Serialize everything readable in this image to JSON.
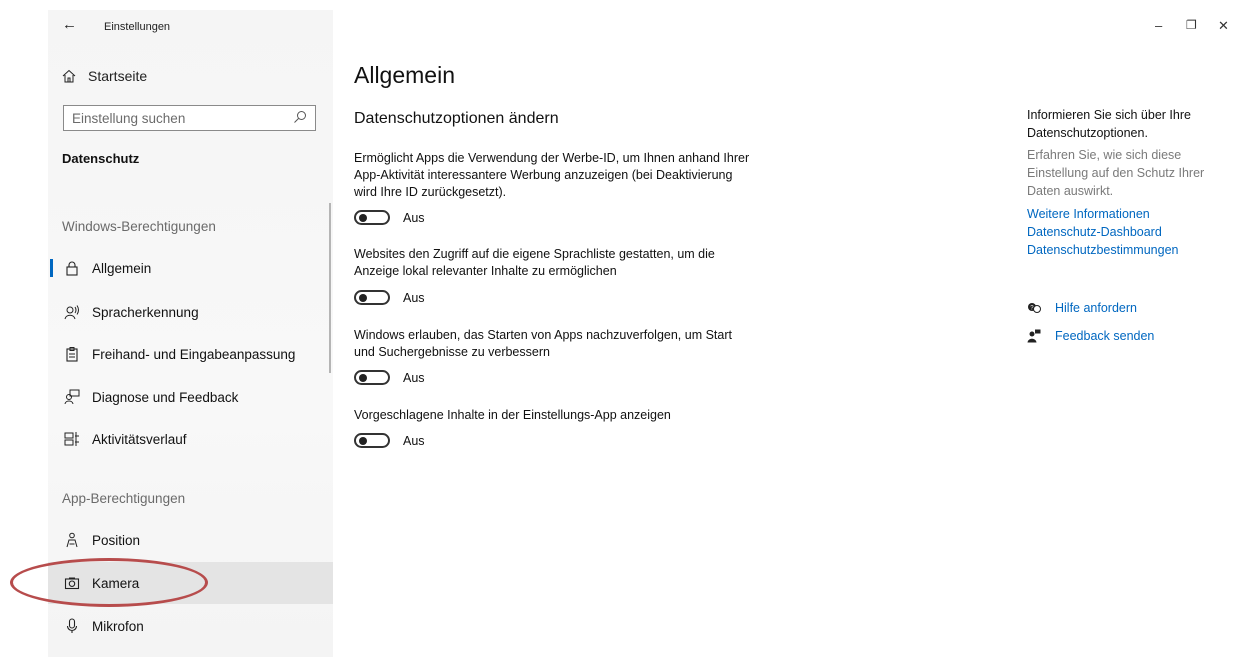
{
  "window": {
    "title": "Einstellungen",
    "controls": {
      "minimize": "–",
      "restore": "❐",
      "close": "✕"
    }
  },
  "sidebar": {
    "home_label": "Startseite",
    "search_placeholder": "Einstellung suchen",
    "section": "Datenschutz",
    "group_windows": "Windows-Berechtigungen",
    "group_app": "App-Berechtigungen",
    "items": [
      {
        "label": "Allgemein",
        "icon": "lock-icon"
      },
      {
        "label": "Spracherkennung",
        "icon": "speech-icon"
      },
      {
        "label": "Freihand- und Eingabeanpassung",
        "icon": "clipboard-icon"
      },
      {
        "label": "Diagnose und Feedback",
        "icon": "feedback-person-icon"
      },
      {
        "label": "Aktivitätsverlauf",
        "icon": "timeline-icon"
      },
      {
        "label": "Position",
        "icon": "location-person-icon"
      },
      {
        "label": "Kamera",
        "icon": "camera-icon"
      },
      {
        "label": "Mikrofon",
        "icon": "microphone-icon"
      }
    ]
  },
  "main": {
    "title": "Allgemein",
    "subtitle": "Datenschutzoptionen ändern",
    "options": [
      {
        "desc": "Ermöglicht Apps die Verwendung der Werbe-ID, um Ihnen anhand Ihrer App-Aktivität interessantere Werbung anzuzeigen (bei Deaktivierung wird Ihre ID zurückgesetzt).",
        "state": "Aus"
      },
      {
        "desc": "Websites den Zugriff auf die eigene Sprachliste gestatten, um die Anzeige lokal relevanter Inhalte zu ermöglichen",
        "state": "Aus"
      },
      {
        "desc": "Windows erlauben, das Starten von Apps nachzuverfolgen, um Start und Suchergebnisse zu verbessern",
        "state": "Aus"
      },
      {
        "desc": "Vorgeschlagene Inhalte in der Einstellungs-App anzeigen",
        "state": "Aus"
      }
    ]
  },
  "right_panel": {
    "info": "Informieren Sie sich über Ihre Datenschutzoptionen.",
    "desc": "Erfahren Sie, wie sich diese Einstellung auf den Schutz Ihrer Daten auswirkt.",
    "links": [
      "Weitere Informationen",
      "Datenschutz-Dashboard",
      "Datenschutzbestimmungen"
    ],
    "help": "Hilfe anfordern",
    "feedback": "Feedback senden"
  },
  "colors": {
    "accent": "#0067c0",
    "highlight_ring": "#b74c4c"
  }
}
